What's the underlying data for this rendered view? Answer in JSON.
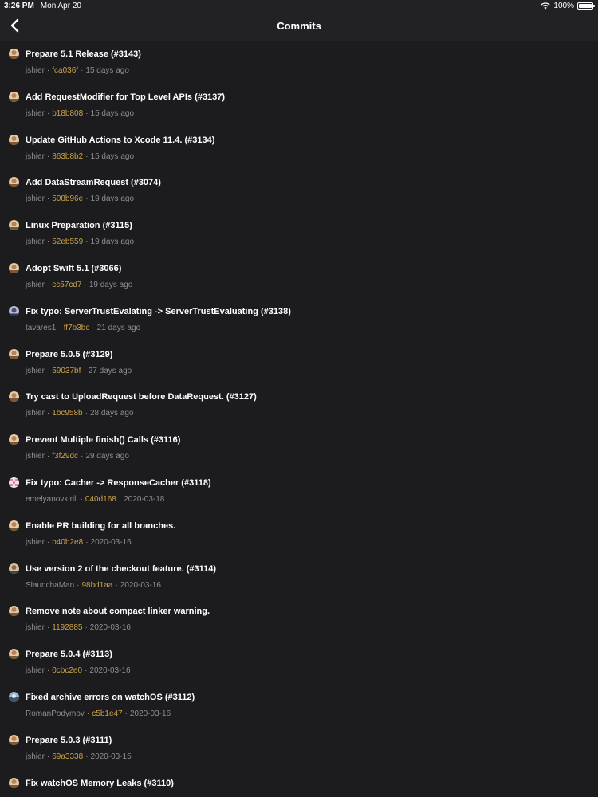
{
  "status_bar": {
    "time": "3:26 PM",
    "date": "Mon Apr 20",
    "battery": "100%"
  },
  "nav": {
    "title": "Commits",
    "back_icon": "chevron-left-icon"
  },
  "colors": {
    "background": "#1c1c1e",
    "bar": "#222224",
    "sha": "#c9a24a",
    "meta": "#8e8e93"
  },
  "meta_separator": "·",
  "commits": [
    {
      "title": "Prepare 5.1 Release (#3143)",
      "author": "jshier",
      "sha": "fca036f",
      "date": "15 days ago",
      "avatar": "jshier"
    },
    {
      "title": "Add RequestModifier for Top Level APIs (#3137)",
      "author": "jshier",
      "sha": "b18b808",
      "date": "15 days ago",
      "avatar": "jshier"
    },
    {
      "title": "Update GitHub Actions to Xcode 11.4. (#3134)",
      "author": "jshier",
      "sha": "863b8b2",
      "date": "15 days ago",
      "avatar": "jshier"
    },
    {
      "title": "Add DataStreamRequest (#3074)",
      "author": "jshier",
      "sha": "508b96e",
      "date": "19 days ago",
      "avatar": "jshier"
    },
    {
      "title": "Linux Preparation (#3115)",
      "author": "jshier",
      "sha": "52eb559",
      "date": "19 days ago",
      "avatar": "jshier"
    },
    {
      "title": "Adopt Swift 5.1 (#3066)",
      "author": "jshier",
      "sha": "cc57cd7",
      "date": "19 days ago",
      "avatar": "jshier"
    },
    {
      "title": "Fix typo: ServerTrustEvalating -> ServerTrustEvaluating (#3138)",
      "author": "tavares1",
      "sha": "ff7b3bc",
      "date": "21 days ago",
      "avatar": "tavares1"
    },
    {
      "title": "Prepare 5.0.5 (#3129)",
      "author": "jshier",
      "sha": "59037bf",
      "date": "27 days ago",
      "avatar": "jshier"
    },
    {
      "title": "Try cast to UploadRequest before DataRequest. (#3127)",
      "author": "jshier",
      "sha": "1bc958b",
      "date": "28 days ago",
      "avatar": "jshier"
    },
    {
      "title": "Prevent Multiple finish() Calls (#3116)",
      "author": "jshier",
      "sha": "f3f29dc",
      "date": "29 days ago",
      "avatar": "jshier"
    },
    {
      "title": "Fix typo: Cacher -> ResponseCacher (#3118)",
      "author": "emelyanovkirill",
      "sha": "040d168",
      "date": "2020-03-18",
      "avatar": "emelyanovkirill"
    },
    {
      "title": "Enable PR building for all branches.",
      "author": "jshier",
      "sha": "b40b2e8",
      "date": "2020-03-16",
      "avatar": "jshier"
    },
    {
      "title": "Use version 2 of the checkout feature. (#3114)",
      "author": "SlaunchaMan",
      "sha": "98bd1aa",
      "date": "2020-03-16",
      "avatar": "SlaunchaMan"
    },
    {
      "title": "Remove note about compact linker warning.",
      "author": "jshier",
      "sha": "1192885",
      "date": "2020-03-16",
      "avatar": "jshier"
    },
    {
      "title": "Prepare 5.0.4 (#3113)",
      "author": "jshier",
      "sha": "0cbc2e0",
      "date": "2020-03-16",
      "avatar": "jshier"
    },
    {
      "title": "Fixed archive errors on watchOS (#3112)",
      "author": "RomanPodymov",
      "sha": "c5b1e47",
      "date": "2020-03-16",
      "avatar": "RomanPodymov"
    },
    {
      "title": "Prepare 5.0.3 (#3111)",
      "author": "jshier",
      "sha": "69a3338",
      "date": "2020-03-15",
      "avatar": "jshier"
    },
    {
      "title": "Fix watchOS Memory Leaks (#3110)",
      "author": "",
      "sha": "",
      "date": "",
      "avatar": "jshier"
    }
  ]
}
